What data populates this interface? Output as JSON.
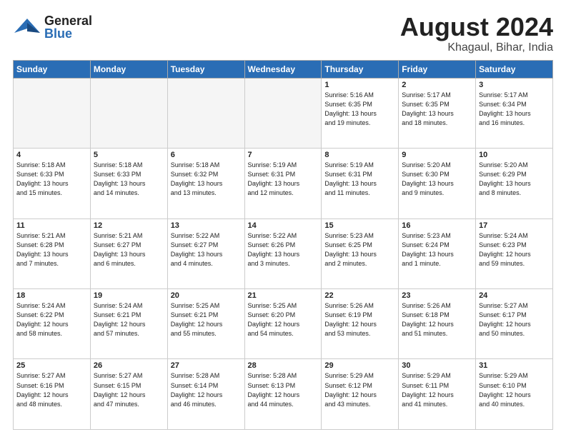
{
  "header": {
    "logo_general": "General",
    "logo_blue": "Blue",
    "title": "August 2024",
    "subtitle": "Khagaul, Bihar, India"
  },
  "days_of_week": [
    "Sunday",
    "Monday",
    "Tuesday",
    "Wednesday",
    "Thursday",
    "Friday",
    "Saturday"
  ],
  "weeks": [
    [
      {
        "day": "",
        "info": ""
      },
      {
        "day": "",
        "info": ""
      },
      {
        "day": "",
        "info": ""
      },
      {
        "day": "",
        "info": ""
      },
      {
        "day": "1",
        "info": "Sunrise: 5:16 AM\nSunset: 6:35 PM\nDaylight: 13 hours\nand 19 minutes."
      },
      {
        "day": "2",
        "info": "Sunrise: 5:17 AM\nSunset: 6:35 PM\nDaylight: 13 hours\nand 18 minutes."
      },
      {
        "day": "3",
        "info": "Sunrise: 5:17 AM\nSunset: 6:34 PM\nDaylight: 13 hours\nand 16 minutes."
      }
    ],
    [
      {
        "day": "4",
        "info": "Sunrise: 5:18 AM\nSunset: 6:33 PM\nDaylight: 13 hours\nand 15 minutes."
      },
      {
        "day": "5",
        "info": "Sunrise: 5:18 AM\nSunset: 6:33 PM\nDaylight: 13 hours\nand 14 minutes."
      },
      {
        "day": "6",
        "info": "Sunrise: 5:18 AM\nSunset: 6:32 PM\nDaylight: 13 hours\nand 13 minutes."
      },
      {
        "day": "7",
        "info": "Sunrise: 5:19 AM\nSunset: 6:31 PM\nDaylight: 13 hours\nand 12 minutes."
      },
      {
        "day": "8",
        "info": "Sunrise: 5:19 AM\nSunset: 6:31 PM\nDaylight: 13 hours\nand 11 minutes."
      },
      {
        "day": "9",
        "info": "Sunrise: 5:20 AM\nSunset: 6:30 PM\nDaylight: 13 hours\nand 9 minutes."
      },
      {
        "day": "10",
        "info": "Sunrise: 5:20 AM\nSunset: 6:29 PM\nDaylight: 13 hours\nand 8 minutes."
      }
    ],
    [
      {
        "day": "11",
        "info": "Sunrise: 5:21 AM\nSunset: 6:28 PM\nDaylight: 13 hours\nand 7 minutes."
      },
      {
        "day": "12",
        "info": "Sunrise: 5:21 AM\nSunset: 6:27 PM\nDaylight: 13 hours\nand 6 minutes."
      },
      {
        "day": "13",
        "info": "Sunrise: 5:22 AM\nSunset: 6:27 PM\nDaylight: 13 hours\nand 4 minutes."
      },
      {
        "day": "14",
        "info": "Sunrise: 5:22 AM\nSunset: 6:26 PM\nDaylight: 13 hours\nand 3 minutes."
      },
      {
        "day": "15",
        "info": "Sunrise: 5:23 AM\nSunset: 6:25 PM\nDaylight: 13 hours\nand 2 minutes."
      },
      {
        "day": "16",
        "info": "Sunrise: 5:23 AM\nSunset: 6:24 PM\nDaylight: 13 hours\nand 1 minute."
      },
      {
        "day": "17",
        "info": "Sunrise: 5:24 AM\nSunset: 6:23 PM\nDaylight: 12 hours\nand 59 minutes."
      }
    ],
    [
      {
        "day": "18",
        "info": "Sunrise: 5:24 AM\nSunset: 6:22 PM\nDaylight: 12 hours\nand 58 minutes."
      },
      {
        "day": "19",
        "info": "Sunrise: 5:24 AM\nSunset: 6:21 PM\nDaylight: 12 hours\nand 57 minutes."
      },
      {
        "day": "20",
        "info": "Sunrise: 5:25 AM\nSunset: 6:21 PM\nDaylight: 12 hours\nand 55 minutes."
      },
      {
        "day": "21",
        "info": "Sunrise: 5:25 AM\nSunset: 6:20 PM\nDaylight: 12 hours\nand 54 minutes."
      },
      {
        "day": "22",
        "info": "Sunrise: 5:26 AM\nSunset: 6:19 PM\nDaylight: 12 hours\nand 53 minutes."
      },
      {
        "day": "23",
        "info": "Sunrise: 5:26 AM\nSunset: 6:18 PM\nDaylight: 12 hours\nand 51 minutes."
      },
      {
        "day": "24",
        "info": "Sunrise: 5:27 AM\nSunset: 6:17 PM\nDaylight: 12 hours\nand 50 minutes."
      }
    ],
    [
      {
        "day": "25",
        "info": "Sunrise: 5:27 AM\nSunset: 6:16 PM\nDaylight: 12 hours\nand 48 minutes."
      },
      {
        "day": "26",
        "info": "Sunrise: 5:27 AM\nSunset: 6:15 PM\nDaylight: 12 hours\nand 47 minutes."
      },
      {
        "day": "27",
        "info": "Sunrise: 5:28 AM\nSunset: 6:14 PM\nDaylight: 12 hours\nand 46 minutes."
      },
      {
        "day": "28",
        "info": "Sunrise: 5:28 AM\nSunset: 6:13 PM\nDaylight: 12 hours\nand 44 minutes."
      },
      {
        "day": "29",
        "info": "Sunrise: 5:29 AM\nSunset: 6:12 PM\nDaylight: 12 hours\nand 43 minutes."
      },
      {
        "day": "30",
        "info": "Sunrise: 5:29 AM\nSunset: 6:11 PM\nDaylight: 12 hours\nand 41 minutes."
      },
      {
        "day": "31",
        "info": "Sunrise: 5:29 AM\nSunset: 6:10 PM\nDaylight: 12 hours\nand 40 minutes."
      }
    ]
  ]
}
